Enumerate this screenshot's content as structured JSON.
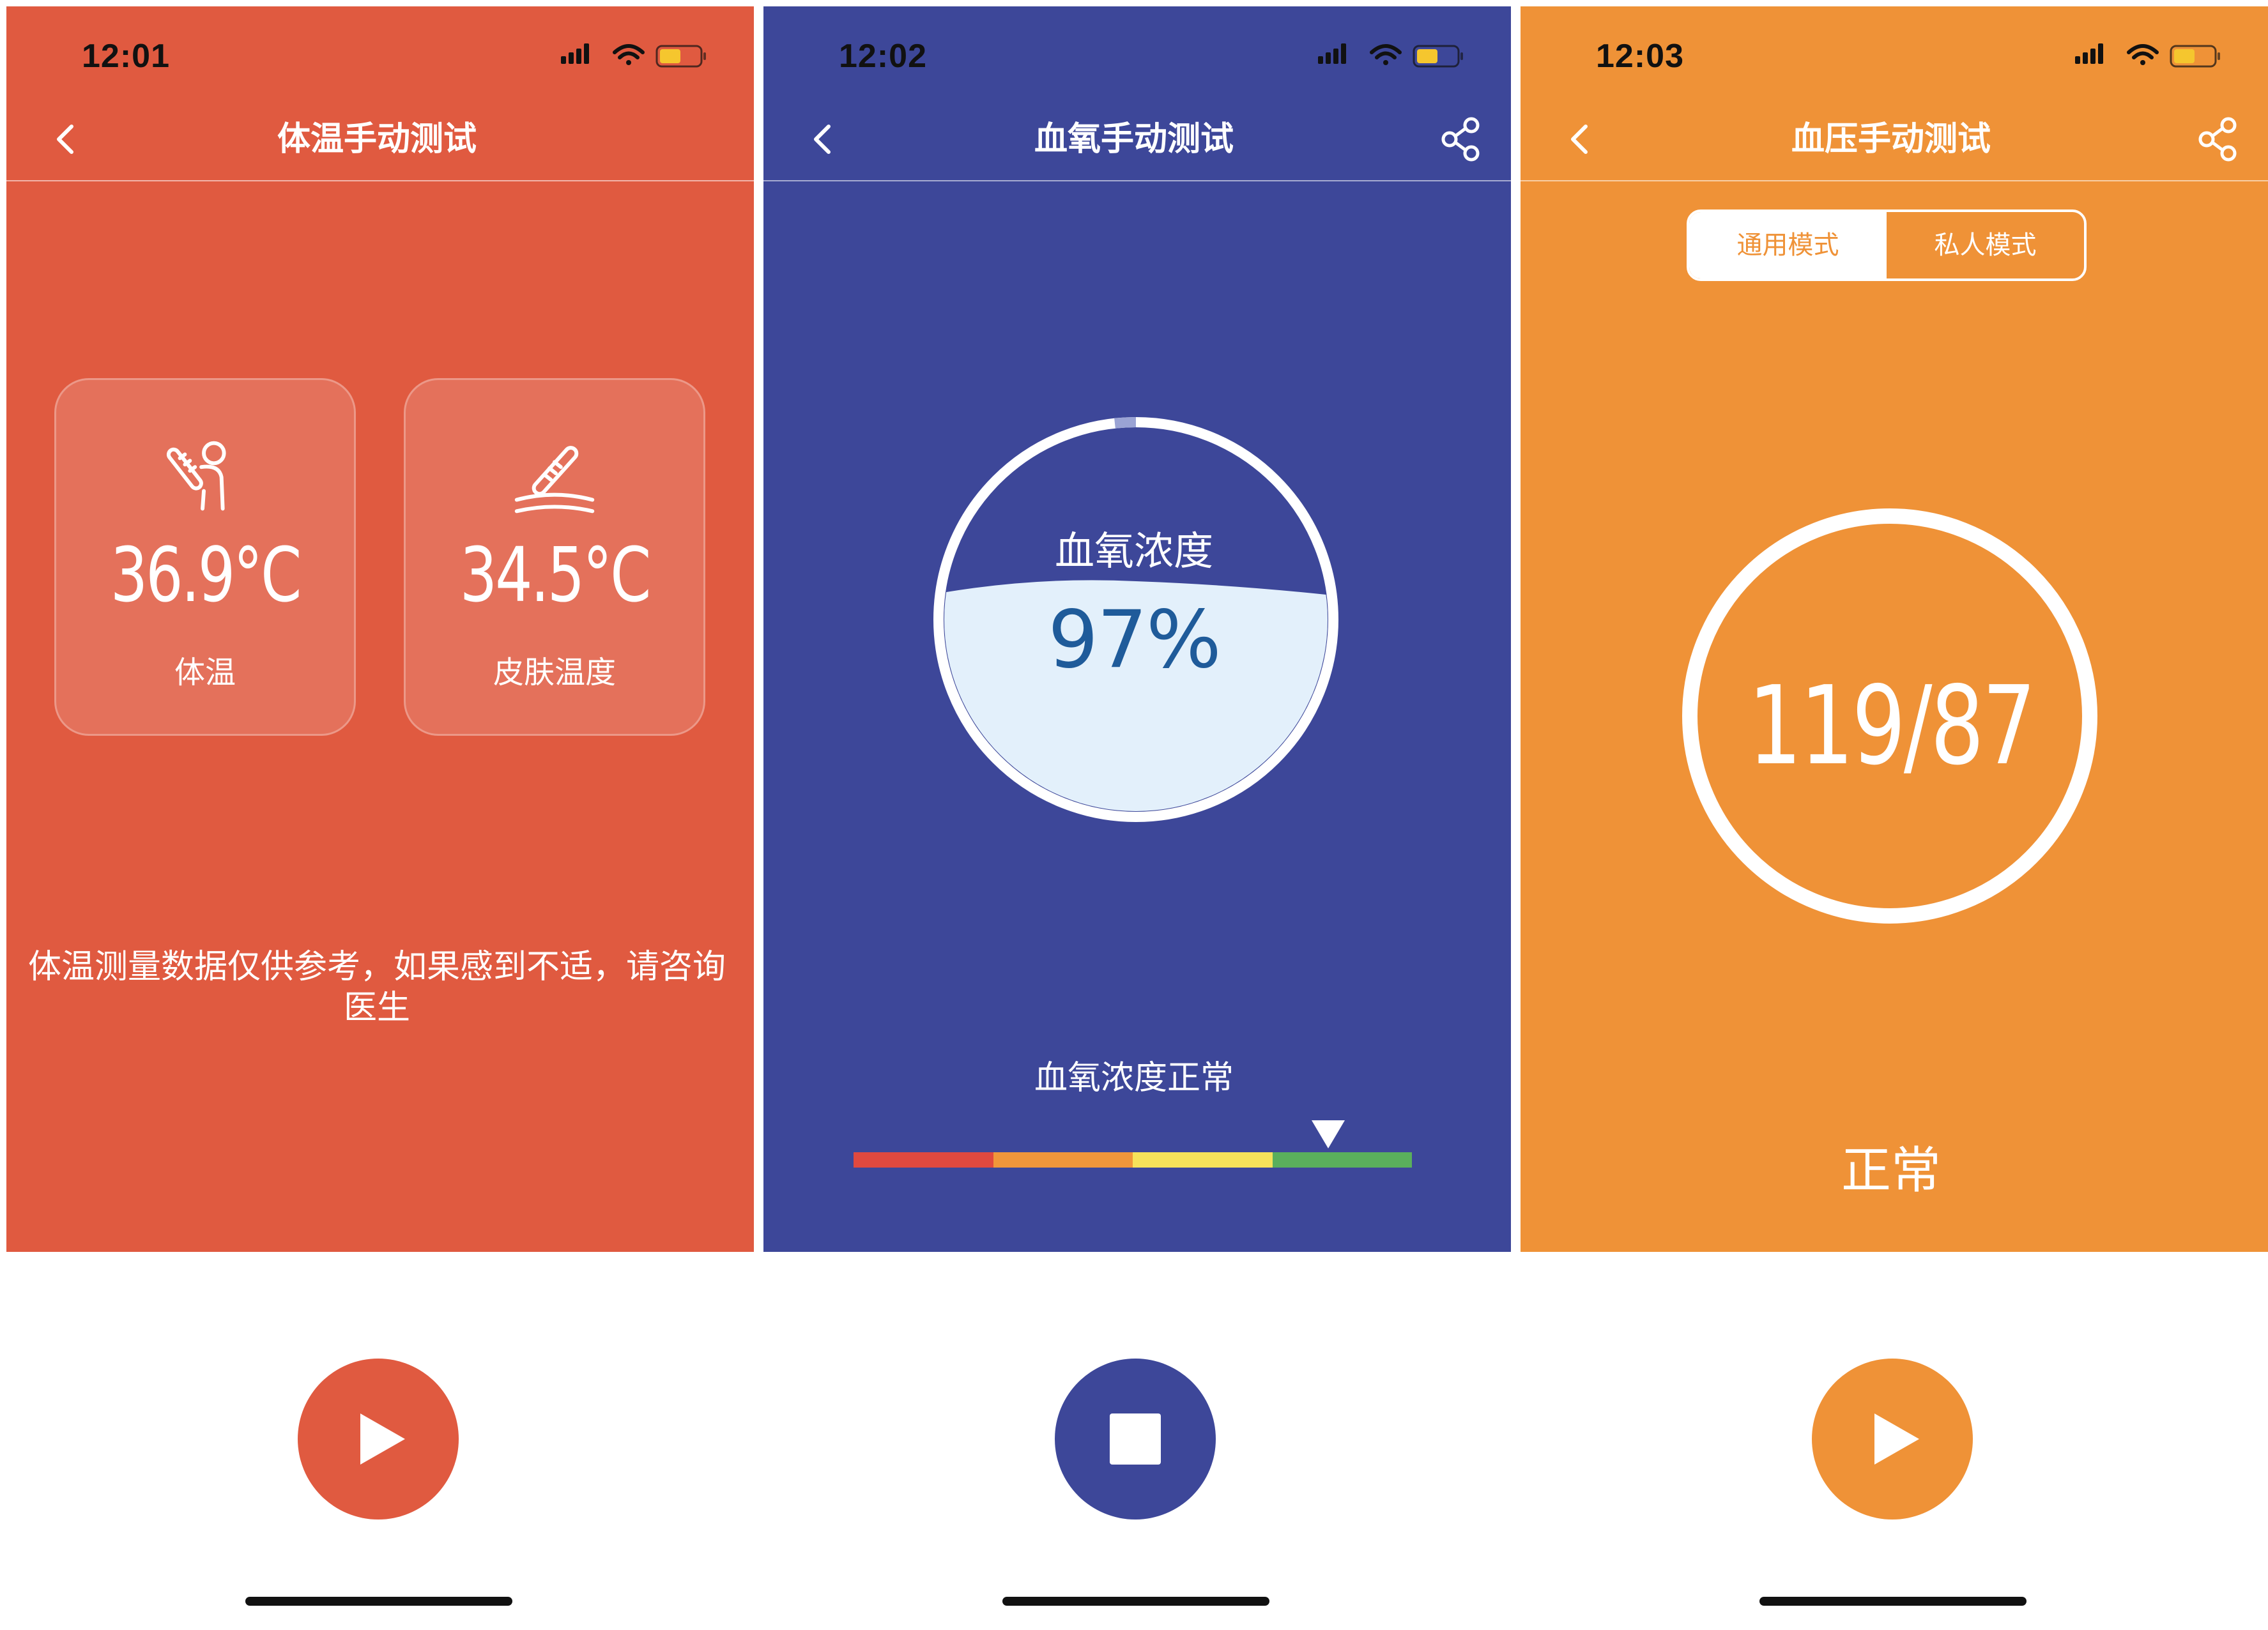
{
  "screens": [
    {
      "id": "temperature",
      "status_time": "12:01",
      "title": "体温手动测试",
      "cards": [
        {
          "value": "36.9°C",
          "label": "体温",
          "icon": "thermometer-person-icon"
        },
        {
          "value": "34.5°C",
          "label": "皮肤温度",
          "icon": "thermometer-skin-icon"
        }
      ],
      "note": "体温测量数据仅供参考，如果感到不适，请咨询医生",
      "control": "play-icon"
    },
    {
      "id": "blood-oxygen",
      "status_time": "12:02",
      "title": "血氧手动测试",
      "gauge_label": "血氧浓度",
      "gauge_value": "97%",
      "gauge_fraction": 0.97,
      "status_text": "血氧浓度正常",
      "scale_colors": [
        "#E0493F",
        "#F0963A",
        "#F6E25A",
        "#5AAF5C"
      ],
      "scale_marker_position": 0.85,
      "control": "stop-icon"
    },
    {
      "id": "blood-pressure",
      "status_time": "12:03",
      "title": "血压手动测试",
      "modes": [
        "通用模式",
        "私人模式"
      ],
      "active_mode": 0,
      "value": "119/87",
      "status_text": "正常",
      "control": "play-icon"
    }
  ],
  "colors": {
    "temperature": "#E05A40",
    "blood_oxygen": "#3D4799",
    "blood_pressure": "#EF9237",
    "gauge_fill": "#E3F0FB",
    "gauge_text": "#1F5B9A"
  }
}
